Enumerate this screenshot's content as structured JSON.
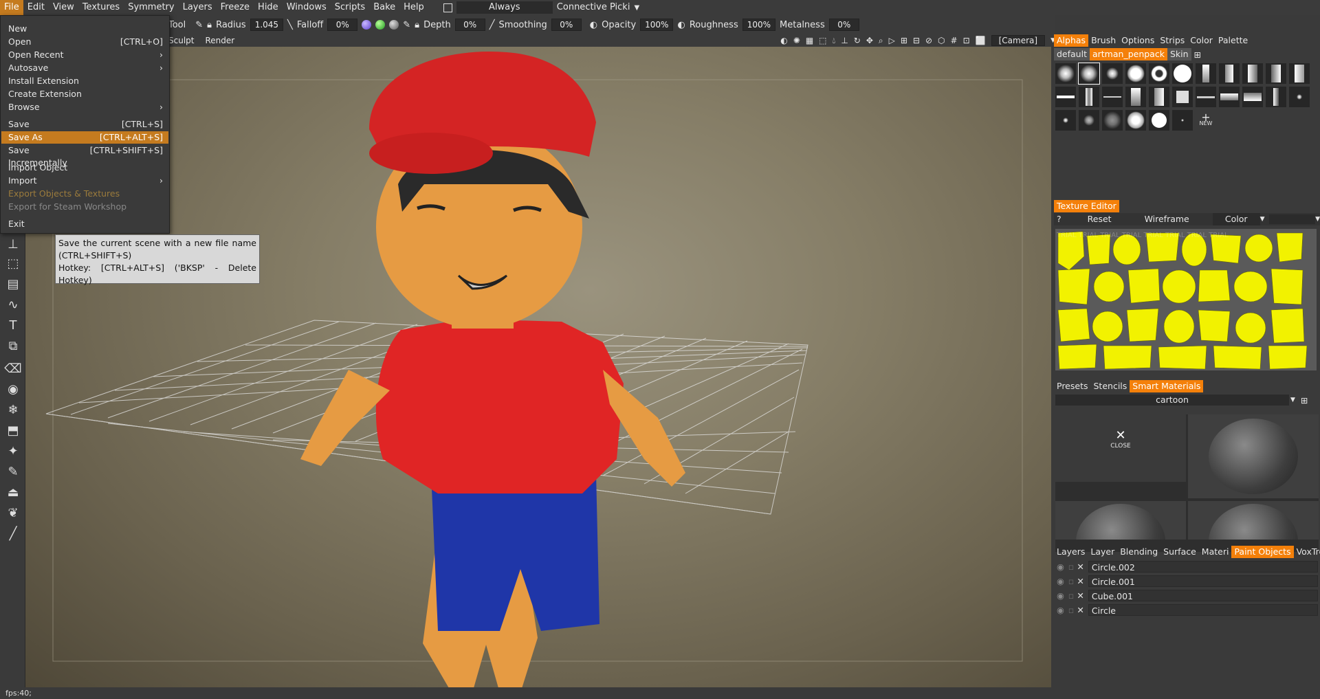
{
  "menubar": {
    "items": [
      "File",
      "Edit",
      "View",
      "Textures",
      "Symmetry",
      "Layers",
      "Freeze",
      "Hide",
      "Windows",
      "Scripts",
      "Bake",
      "Help"
    ],
    "always": "Always",
    "connective": "Connective Picki"
  },
  "toolbar": {
    "tool": "Tool",
    "radius_label": "Radius",
    "radius_value": "1.045",
    "falloff_label": "Falloff",
    "falloff_value": "0%",
    "depth_label": "Depth",
    "depth_value": "0%",
    "smoothing_label": "Smoothing",
    "smoothing_value": "0%",
    "opacity_label": "Opacity",
    "opacity_value": "100%",
    "roughness_label": "Roughness",
    "roughness_value": "100%",
    "metalness_label": "Metalness",
    "metalness_value": "0%"
  },
  "subbar": {
    "sculpt": "Sculpt",
    "render": "Render",
    "camera": "[Camera]"
  },
  "file_menu": {
    "items": [
      {
        "label": "New",
        "hotkey": ""
      },
      {
        "label": "Open",
        "hotkey": "[CTRL+O]"
      },
      {
        "label": "Open Recent",
        "hotkey": "›"
      },
      {
        "label": "Autosave",
        "hotkey": "›"
      },
      {
        "label": "Install Extension",
        "hotkey": ""
      },
      {
        "label": "Create Extension",
        "hotkey": ""
      },
      {
        "label": "Browse",
        "hotkey": "›"
      },
      {
        "label": "Save",
        "hotkey": "[CTRL+S]"
      },
      {
        "label": "Save As",
        "hotkey": "[CTRL+ALT+S]"
      },
      {
        "label": "Save Incrementally",
        "hotkey": "[CTRL+SHIFT+S]"
      },
      {
        "label": "Import Object",
        "hotkey": ""
      },
      {
        "label": "Import",
        "hotkey": "›"
      },
      {
        "label": "Export Objects & Textures",
        "hotkey": ""
      },
      {
        "label": "Export for Steam Workshop",
        "hotkey": ""
      },
      {
        "label": "Exit",
        "hotkey": ""
      }
    ]
  },
  "tooltip": {
    "line1": "Save the current scene with a new file name (CTRL+SHIFT+S)",
    "line2": "Hotkey: [CTRL+ALT+S]   ('BKSP' - Delete Hotkey)"
  },
  "alphas_panel": {
    "tabs": [
      "Alphas",
      "Brush",
      "Options",
      "Strips",
      "Color",
      "Palette"
    ],
    "subtabs": [
      "default",
      "artman_penpack",
      "Skin"
    ],
    "new_label": "NEW"
  },
  "texture_editor": {
    "title": "Texture Editor",
    "help": "?",
    "reset": "Reset",
    "wireframe": "Wireframe",
    "color": "Color",
    "watermark": "TRIAL TRIAL TRIAL TRIAL TRIAL TRIAL TRIAL TRIAL"
  },
  "materials_panel": {
    "tabs": [
      "Presets",
      "Stencils",
      "Smart Materials"
    ],
    "folder": "cartoon",
    "close_label": "CLOSE"
  },
  "objects_panel": {
    "tabs": [
      "Layers",
      "Layer",
      "Blending",
      "Surface",
      "Materi",
      "Paint Objects",
      "VoxTree"
    ],
    "objects": [
      "Circle.002",
      "Circle.001",
      "Cube.001",
      "Circle"
    ]
  },
  "status": {
    "fps": "fps:40;"
  }
}
